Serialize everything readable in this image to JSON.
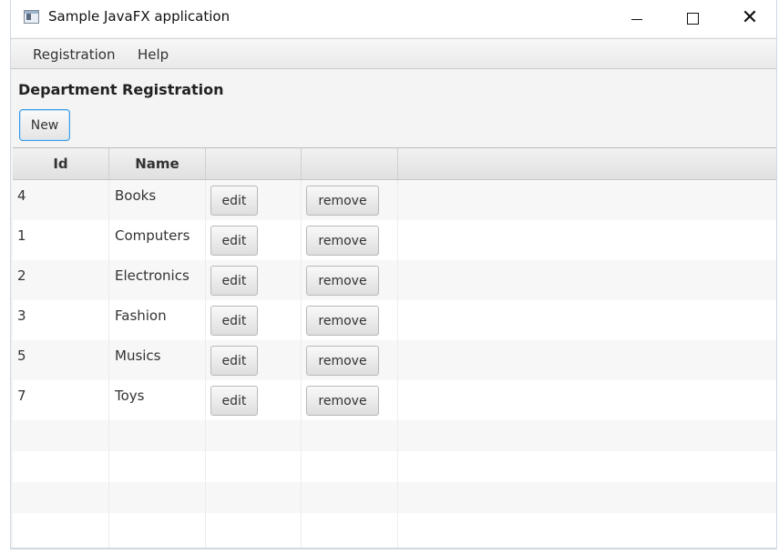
{
  "window": {
    "title": "Sample JavaFX application"
  },
  "menu": {
    "items": [
      "Registration",
      "Help"
    ]
  },
  "page": {
    "heading": "Department Registration",
    "new_button": "New"
  },
  "table": {
    "columns": [
      "Id",
      "Name",
      "",
      ""
    ],
    "rows": [
      {
        "id": "4",
        "name": "Books",
        "edit": "edit",
        "remove": "remove"
      },
      {
        "id": "1",
        "name": "Computers",
        "edit": "edit",
        "remove": "remove"
      },
      {
        "id": "2",
        "name": "Electronics",
        "edit": "edit",
        "remove": "remove"
      },
      {
        "id": "3",
        "name": "Fashion",
        "edit": "edit",
        "remove": "remove"
      },
      {
        "id": "5",
        "name": "Musics",
        "edit": "edit",
        "remove": "remove"
      },
      {
        "id": "7",
        "name": "Toys",
        "edit": "edit",
        "remove": "remove"
      }
    ]
  },
  "icons": {
    "app": "app-window-icon",
    "minimize": "minimize-icon",
    "maximize": "maximize-icon",
    "close": "close-icon"
  },
  "colors": {
    "focus_border": "#3b9ae1",
    "row_alt": "#f7f7f7",
    "header_bg": "#e6e6e6"
  }
}
